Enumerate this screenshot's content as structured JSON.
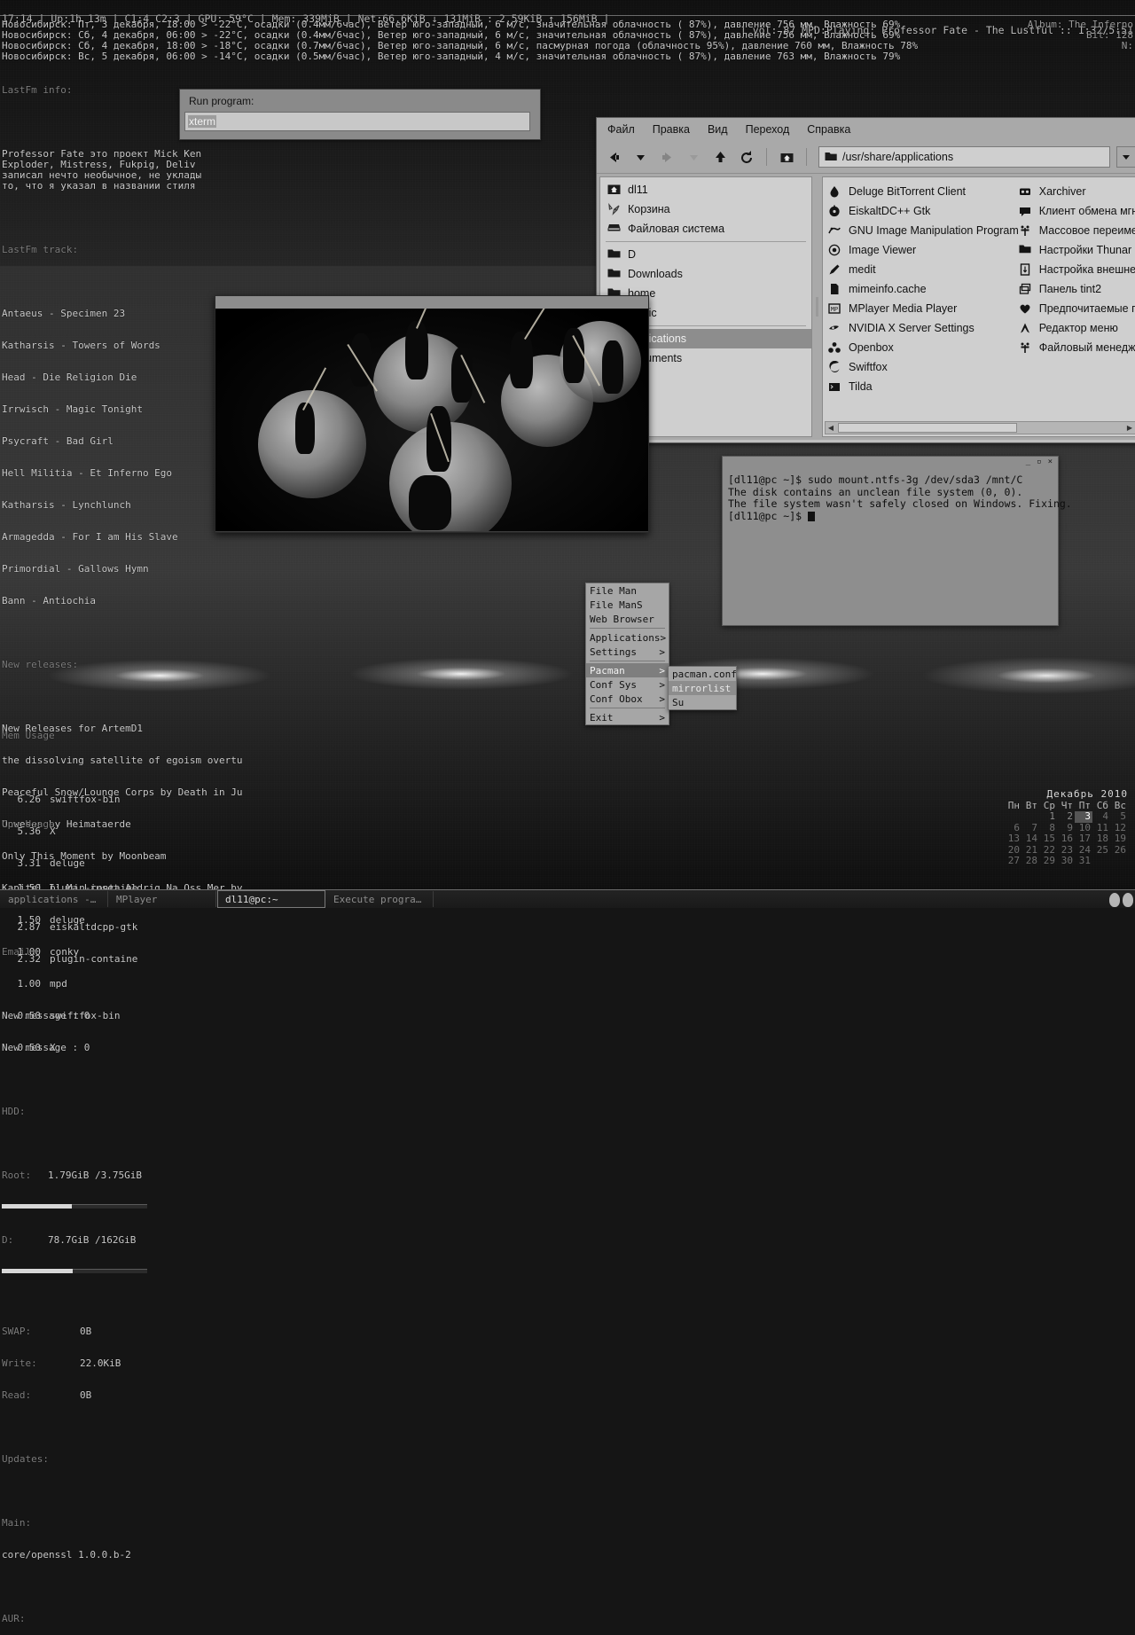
{
  "topbar": {
    "left": "17:14 | Up:1h 13m | C1:4 C2:3 | GPU: 59°C | Mem: 339MiB | Net:66.6KiB ↓ 131MiB : 2.59KiB ↑ 156MiB |",
    "right": "| vol: 87 MPD:Playing: Professor Fate - The Lustful :: 1:32/5:51"
  },
  "weather": [
    "Новосибирск: Пт, 3 декабря, 18:00 > -22°C, осадки (0.4мм/6час), Ветер юго-западный, 6 м/с, значительная облачность ( 87%), давление 756 мм, Влажность 69%",
    "Новосибирск: Сб, 4 декабря, 06:00 > -22°C, осадки (0.4мм/6час), Ветер юго-западный, 6 м/с, значительная облачность ( 87%), давление 756 мм, Влажность 69%",
    "Новосибирск: Сб, 4 декабря, 18:00 > -18°C, осадки (0.7мм/6час), Ветер юго-западный, 6 м/с, пасмурная погода (облачность 95%), давление 760 мм, Влажность 78%",
    "Новосибирск: Вс, 5 декабря, 06:00 > -14°C, осадки (0.5мм/6час), Ветер юго-западный, 4 м/с, значительная облачность ( 87%), давление 763 мм, Влажность 79%"
  ],
  "mpd_right": [
    "Album: The Inferno",
    "Bit: 128",
    "N:"
  ],
  "conky_left": {
    "lastfm_info_header": "LastFm info:",
    "lastfm_info_text": "Professor Fate это проект Mick Ken\nExploder, Mistress, Fukpig, Deliv\nзаписал нечто необычное, не уклады\nто, что я указал в названии стиля",
    "lastfm_track_header": "LastFm track:",
    "tracks": [
      "Antaeus - Specimen 23",
      "Katharsis - Towers of Words",
      "Head - Die Religion Die",
      "Irrwisch - Magic Tonight",
      "Psycraft - Bad Girl",
      "Hell Militia - Et Inferno Ego",
      "Katharsis - Lynchlunch",
      "Armagedda - For I am His Slave",
      "Primordial - Gallows Hymn",
      "Bann - Antiochia"
    ],
    "releases_header": "New releases:",
    "releases": [
      "New Releases for ArtemD1",
      "the dissolving satellite of egoism overtu",
      "Peaceful Snow/Lounge Corps by Death in Ju",
      "Unwesen by Heimataerde",
      "Only This Moment by Moonbeam",
      "Kapitel I: Ma Ljuset Aldrig Na Oss Mer by"
    ],
    "email_header": "Email:",
    "email": [
      "New message : 0",
      "New message : 0"
    ],
    "hdd_header": "HDD:",
    "hdd": [
      {
        "label": "Root:",
        "value": "1.79GiB /3.75GiB",
        "pct": 48
      },
      {
        "label": "D:",
        "value": "78.7GiB /162GiB",
        "pct": 49
      }
    ],
    "swap_rows": [
      {
        "label": "SWAP:",
        "value": "0B"
      },
      {
        "label": "Write:",
        "value": "22.0KiB"
      },
      {
        "label": "Read:",
        "value": "0B"
      }
    ],
    "updates_header": "Updates:",
    "main_header": "Main:",
    "main_pkg": "core/openssl 1.0.0.b-2",
    "aur_header": "AUR:"
  },
  "conky_mem": {
    "title": "Mem Usage",
    "rows": [
      {
        "v": "6.26",
        "n": "swiftfox-bin"
      },
      {
        "v": "5.36",
        "n": "X"
      },
      {
        "v": "3.31",
        "n": "deluge"
      },
      {
        "v": "3.17",
        "n": "mplayer"
      },
      {
        "v": "2.87",
        "n": "eiskaltdcpp-gtk"
      },
      {
        "v": "2.32",
        "n": "plugin-containe"
      }
    ]
  },
  "conky_cpu": {
    "title": "Cpu Usage",
    "rows": [
      {
        "v": "1.50",
        "n": "plugin-containe"
      },
      {
        "v": "1.50",
        "n": "deluge"
      },
      {
        "v": "1.00",
        "n": "conky"
      },
      {
        "v": "1.00",
        "n": "mpd"
      },
      {
        "v": "0.50",
        "n": "swiftfox-bin"
      },
      {
        "v": "0.50",
        "n": "X"
      }
    ]
  },
  "calendar": {
    "title": "Декабрь 2010",
    "weekdays": [
      "Пн",
      "Вт",
      "Ср",
      "Чт",
      "Пт",
      "Сб",
      "Вс"
    ],
    "weeks": [
      [
        "",
        "",
        "1",
        "2",
        "3",
        "4",
        "5"
      ],
      [
        "6",
        "7",
        "8",
        "9",
        "10",
        "11",
        "12"
      ],
      [
        "13",
        "14",
        "15",
        "16",
        "17",
        "18",
        "19"
      ],
      [
        "20",
        "21",
        "22",
        "23",
        "24",
        "25",
        "26"
      ],
      [
        "27",
        "28",
        "29",
        "30",
        "31",
        "",
        ""
      ]
    ],
    "today": "3"
  },
  "run_dialog": {
    "label": "Run program:",
    "value": "xterm"
  },
  "thunar": {
    "menu": [
      "Файл",
      "Правка",
      "Вид",
      "Переход",
      "Справка"
    ],
    "path": "/usr/share/applications",
    "toolbar_icons": [
      "back-icon",
      "back-history-icon",
      "forward-icon",
      "forward-history-icon",
      "up-icon",
      "reload-icon",
      "home-icon"
    ],
    "sidebar": [
      {
        "label": "dl11",
        "icon": "home-folder-icon",
        "selected": false
      },
      {
        "label": "Корзина",
        "icon": "trash-icon",
        "selected": false
      },
      {
        "label": "Файловая система",
        "icon": "drive-icon",
        "selected": false
      },
      {
        "label": "D",
        "icon": "folder-icon",
        "selected": false
      },
      {
        "label": "Downloads",
        "icon": "folder-icon",
        "selected": false
      },
      {
        "label": "home",
        "icon": "folder-icon",
        "selected": false
      },
      {
        "label": "music",
        "icon": "folder-icon",
        "selected": false
      },
      {
        "label": "applications",
        "icon": "folder-icon",
        "selected": true
      },
      {
        "label": "documents",
        "icon": "folder-icon",
        "selected": false
      }
    ],
    "files_col1": [
      {
        "label": "Deluge BitTorrent Client",
        "icon": "deluge-icon"
      },
      {
        "label": "EiskaltDC++ Gtk",
        "icon": "eiskaltdc-icon"
      },
      {
        "label": "GNU Image Manipulation Program",
        "icon": "gimp-icon"
      },
      {
        "label": "Image Viewer",
        "icon": "image-viewer-icon"
      },
      {
        "label": "medit",
        "icon": "pencil-icon"
      },
      {
        "label": "mimeinfo.cache",
        "icon": "file-icon"
      },
      {
        "label": "MPlayer Media Player",
        "icon": "mplayer-icon"
      },
      {
        "label": "NVIDIA X Server Settings",
        "icon": "nvidia-icon"
      },
      {
        "label": "Openbox",
        "icon": "openbox-icon"
      },
      {
        "label": "Swiftfox",
        "icon": "swiftfox-icon"
      },
      {
        "label": "Tilda",
        "icon": "terminal-icon"
      }
    ],
    "files_col2": [
      {
        "label": "Xarchiver",
        "icon": "xarchiver-icon"
      },
      {
        "label": "Клиент обмена мгнов",
        "icon": "messenger-icon"
      },
      {
        "label": "Массовое переимен",
        "icon": "bulk-rename-icon"
      },
      {
        "label": "Настройки Thunar",
        "icon": "folder-icon"
      },
      {
        "label": "Настройка внешнего",
        "icon": "appearance-icon"
      },
      {
        "label": "Панель tint2",
        "icon": "panel-icon"
      },
      {
        "label": "Предпочитаемые при",
        "icon": "heart-icon"
      },
      {
        "label": "Редактор меню",
        "icon": "menu-editor-icon"
      },
      {
        "label": "Файловый менеджер",
        "icon": "file-manager-icon"
      }
    ]
  },
  "xterm": {
    "lines": [
      "[dl11@pc ~]$ sudo mount.ntfs-3g /dev/sda3 /mnt/C",
      "The disk contains an unclean file system (0, 0).",
      "The file system wasn't safely closed on Windows. Fixing.",
      "[dl11@pc ~]$ "
    ],
    "buttons": [
      "_",
      "▫",
      "×"
    ]
  },
  "openbox_menu": {
    "items": [
      {
        "label": "File Man",
        "submenu": false,
        "selected": false
      },
      {
        "label": "File ManS",
        "submenu": false,
        "selected": false
      },
      {
        "label": "Web Browser",
        "submenu": false,
        "selected": false
      },
      {
        "sep": true
      },
      {
        "label": "Applications",
        "submenu": true,
        "selected": false
      },
      {
        "label": "Settings",
        "submenu": true,
        "selected": false
      },
      {
        "sep": true
      },
      {
        "label": "Pacman",
        "submenu": true,
        "selected": true
      },
      {
        "label": "Conf Sys",
        "submenu": true,
        "selected": false
      },
      {
        "label": "Conf Obox",
        "submenu": true,
        "selected": false
      },
      {
        "sep": true
      },
      {
        "label": "Exit",
        "submenu": true,
        "selected": false
      }
    ],
    "submenu": [
      {
        "label": "pacman.conf",
        "selected": false
      },
      {
        "label": "mirrorlist",
        "selected": true
      },
      {
        "label": "Su",
        "selected": false
      }
    ]
  },
  "taskbar": {
    "tasks": [
      {
        "label": "applications -…",
        "active": false
      },
      {
        "label": "MPlayer",
        "active": false
      },
      {
        "label": "dl11@pc:~",
        "active": true
      },
      {
        "label": "Execute progra…",
        "active": false
      }
    ]
  }
}
